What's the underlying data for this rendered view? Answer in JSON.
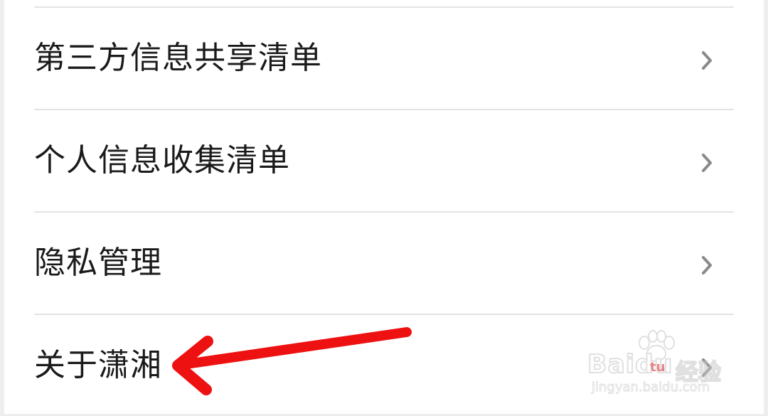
{
  "menu": {
    "items": [
      {
        "label": "第三方信息共享清单"
      },
      {
        "label": "个人信息收集清单"
      },
      {
        "label": "隐私管理"
      },
      {
        "label": "关于潇湘"
      }
    ]
  },
  "watermark": {
    "logo": "Baidu",
    "brand_cn": "经验",
    "url": "jingyan.baidu.com",
    "badge": "tu"
  },
  "icons": {
    "chevron": "chevron-right-icon",
    "arrow": "red-arrow-annotation"
  },
  "colors": {
    "background": "#eeeeee",
    "card": "#ffffff",
    "text": "#1a1a1a",
    "divider": "#e3e3e3",
    "chevron": "#8a8a8a",
    "arrow": "#ee1111"
  }
}
